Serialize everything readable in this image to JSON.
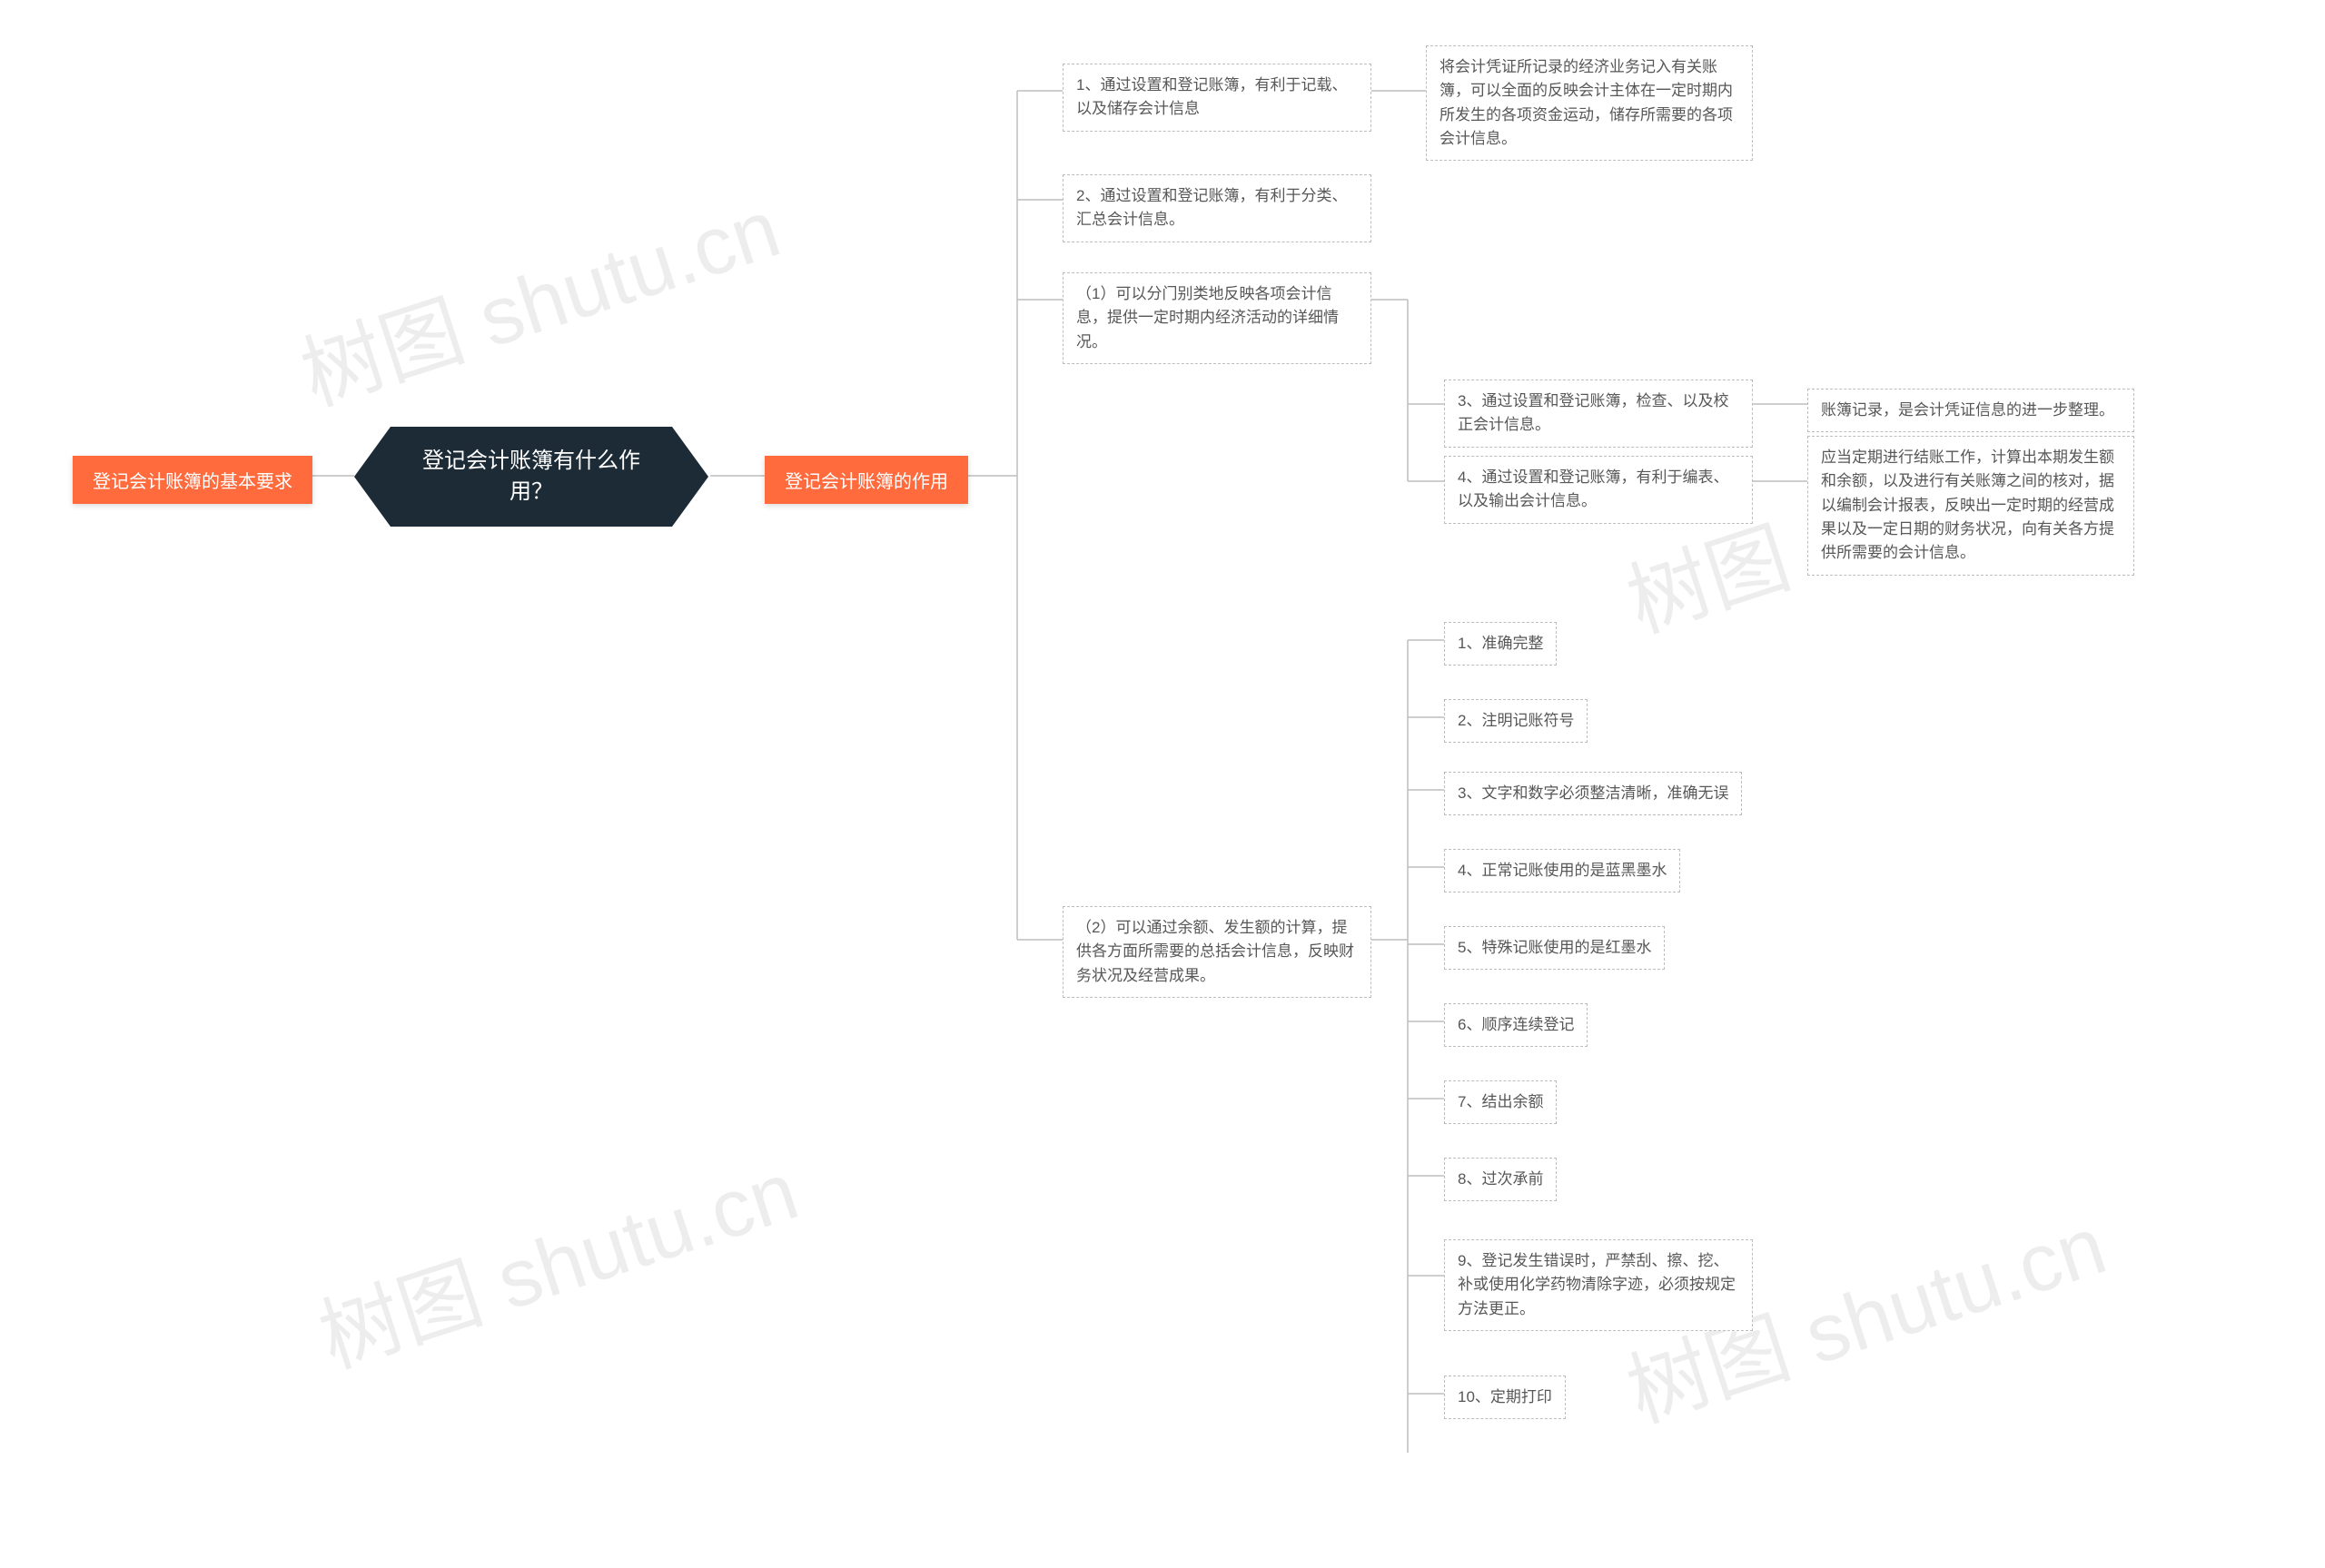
{
  "watermark": "树图 shutu.cn",
  "root": {
    "title": "登记会计账簿有什么作用？"
  },
  "branches": {
    "left": {
      "label": "登记会计账簿的基本要求"
    },
    "right": {
      "label": "登记会计账簿的作用"
    }
  },
  "groupA": {
    "a1": {
      "text": "1、通过设置和登记账簿，有利于记载、以及储存会计信息"
    },
    "a1_detail": {
      "text": "将会计凭证所记录的经济业务记入有关账簿，可以全面的反映会计主体在一定时期内所发生的各项资金运动，储存所需要的各项会计信息。"
    },
    "a2": {
      "text": "2、通过设置和登记账簿，有利于分类、汇总会计信息。"
    },
    "a3": {
      "text": "（1）可以分门别类地反映各项会计信息，提供一定时期内经济活动的详细情况。"
    },
    "a4": {
      "text": "3、通过设置和登记账簿，检查、以及校正会计信息。"
    },
    "a4_detail": {
      "text": "账簿记录，是会计凭证信息的进一步整理。"
    },
    "a5": {
      "text": "4、通过设置和登记账簿，有利于编表、以及输出会计信息。"
    },
    "a5_detail": {
      "text": "应当定期进行结账工作，计算出本期发生额和余额，以及进行有关账簿之间的核对，据以编制会计报表，反映出一定时期的经营成果以及一定日期的财务状况，向有关各方提供所需要的会计信息。"
    }
  },
  "groupB": {
    "b_head": {
      "text": "（2）可以通过余额、发生额的计算，提供各方面所需要的总括会计信息，反映财务状况及经营成果。"
    },
    "b1": {
      "text": "1、准确完整"
    },
    "b2": {
      "text": "2、注明记账符号"
    },
    "b3": {
      "text": "3、文字和数字必须整洁清晰，准确无误"
    },
    "b4": {
      "text": "4、正常记账使用的是蓝黑墨水"
    },
    "b5": {
      "text": "5、特殊记账使用的是红墨水"
    },
    "b6": {
      "text": "6、顺序连续登记"
    },
    "b7": {
      "text": "7、结出余额"
    },
    "b8": {
      "text": "8、过次承前"
    },
    "b9": {
      "text": "9、登记发生错误时，严禁刮、擦、挖、补或使用化学药物清除字迹，必须按规定方法更正。"
    },
    "b10": {
      "text": "10、定期打印"
    }
  }
}
